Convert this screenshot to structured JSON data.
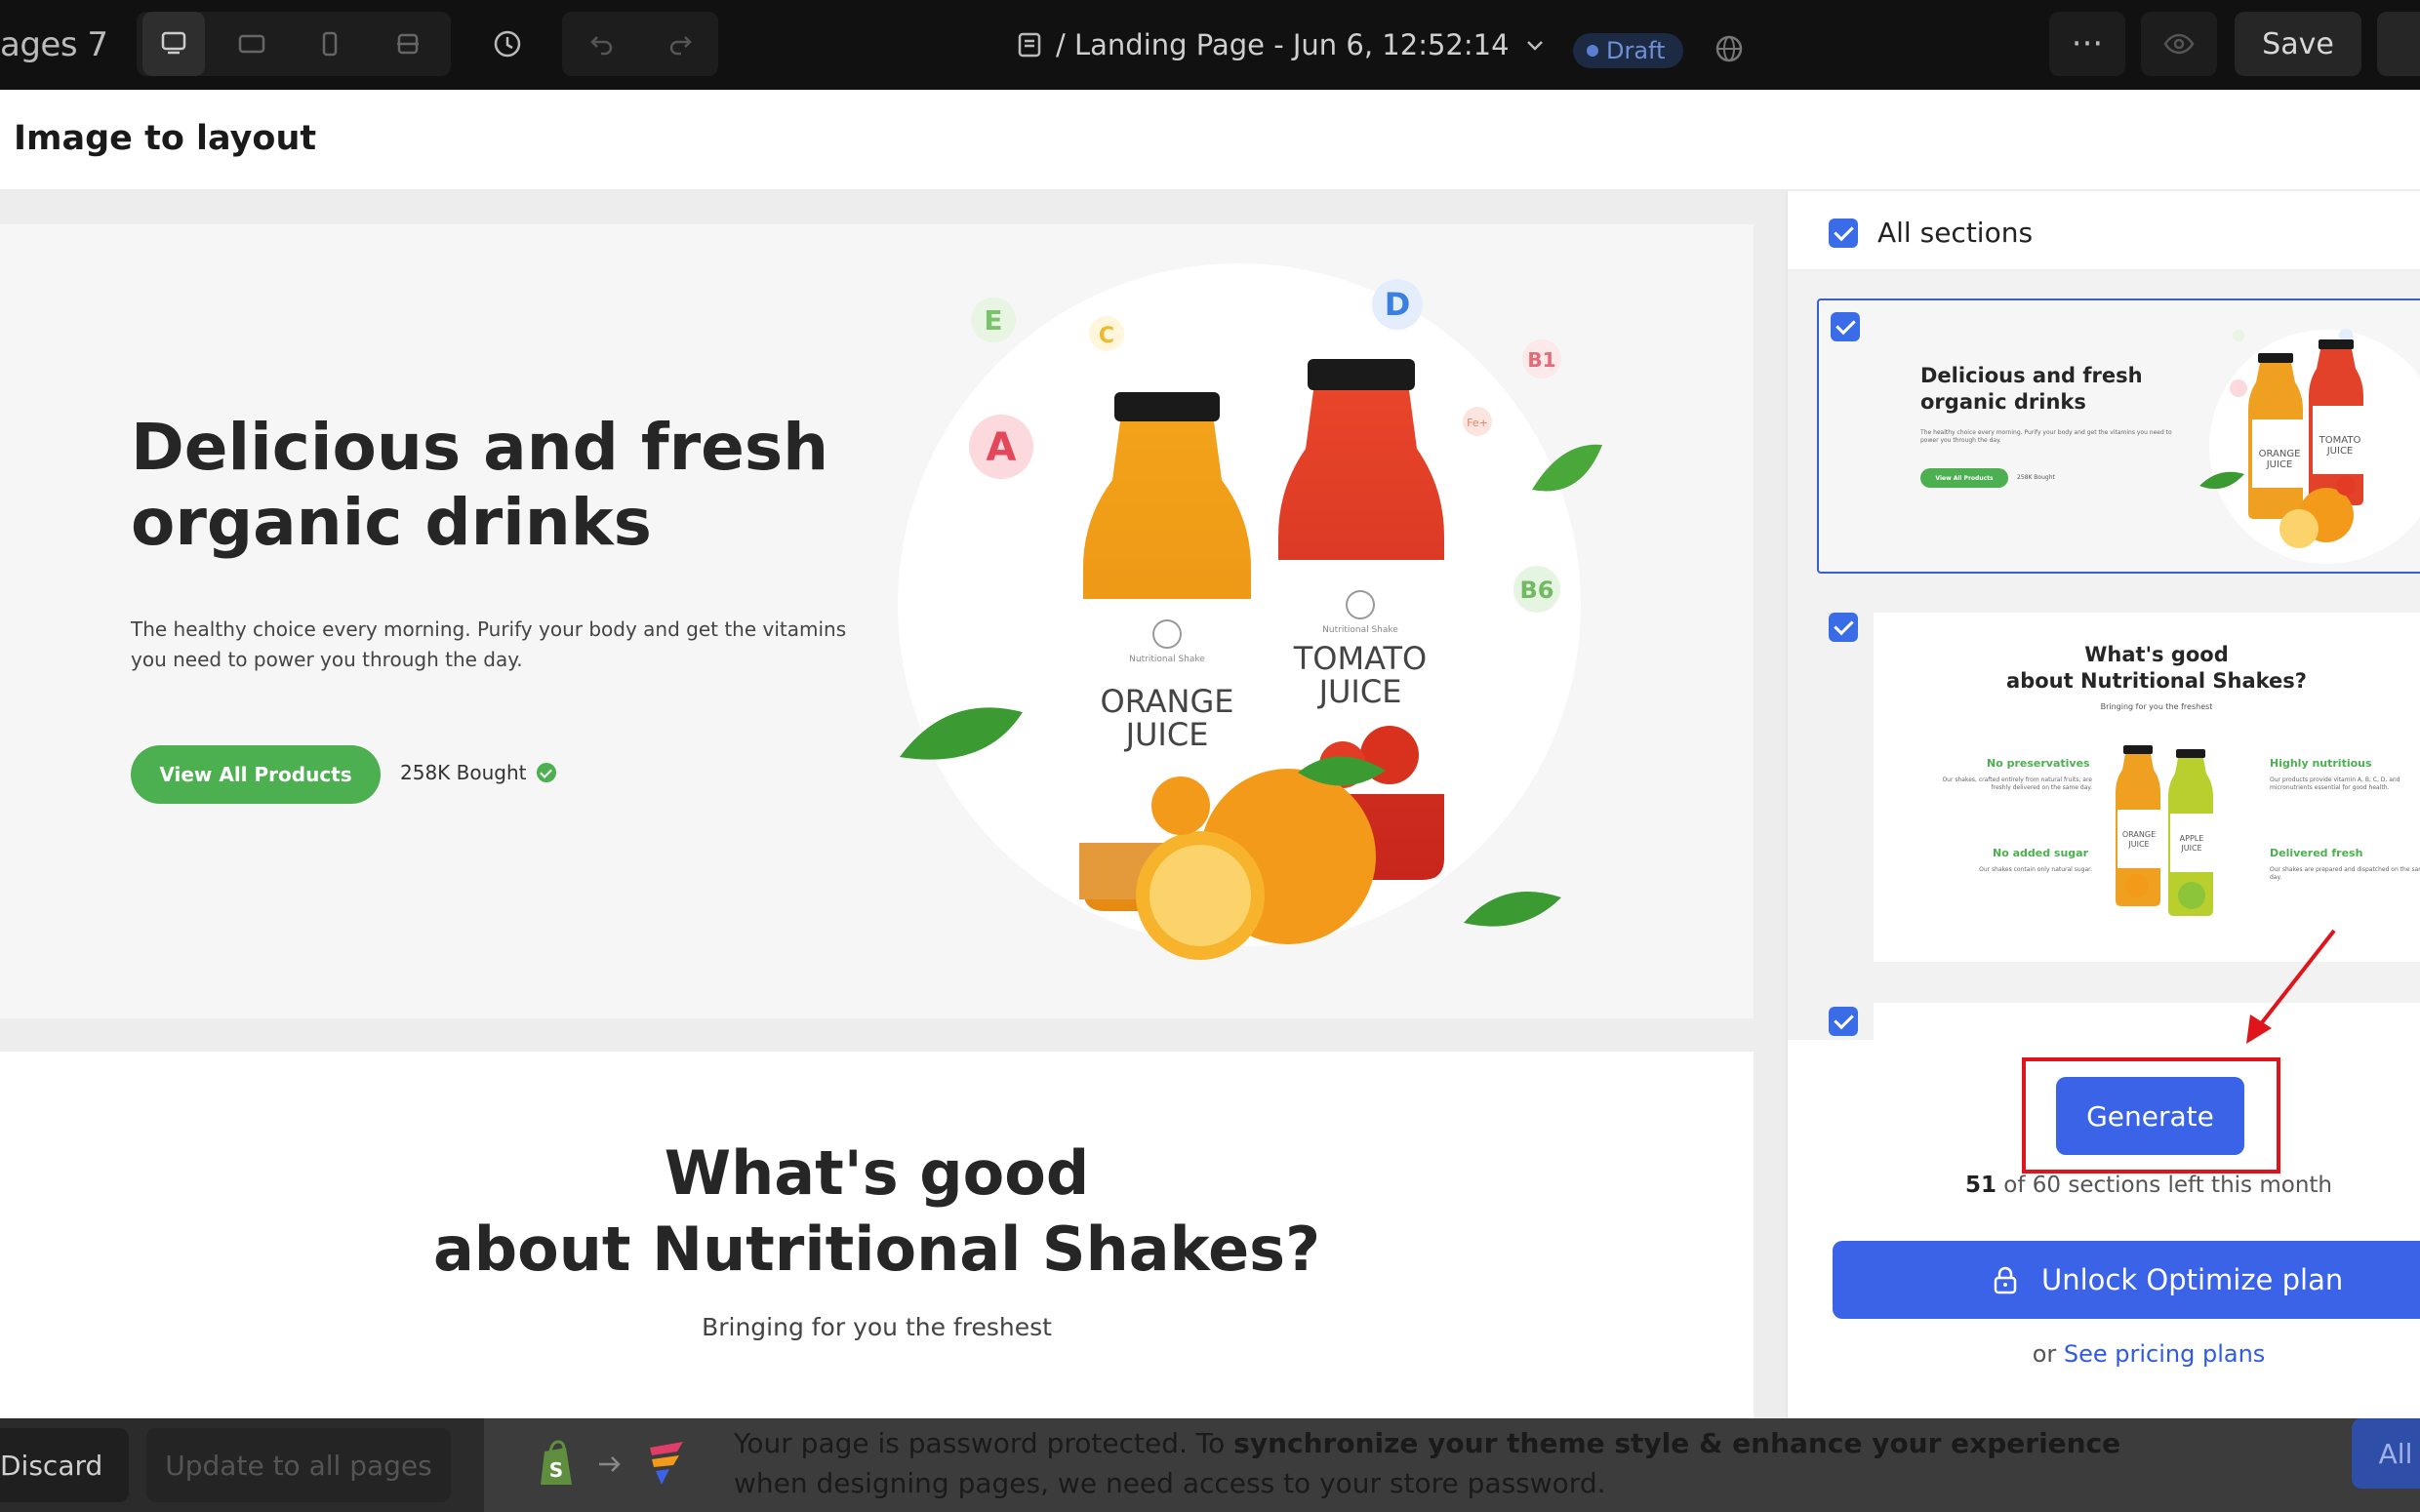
{
  "topbar": {
    "brand": "ages 7",
    "page_title": "/ Landing Page - Jun 6, 12:52:14",
    "draft": "Draft",
    "more": "···",
    "save": "Save"
  },
  "modal": {
    "title": "Image to layout"
  },
  "hero": {
    "title": "Delicious and fresh organic drinks",
    "text": "The healthy choice every morning. Purify your body and get the vitamins you need to power you through the day.",
    "button": "View All Products",
    "bought": "258K Bought",
    "vitamins": [
      "E",
      "C",
      "D",
      "B1",
      "A",
      "Fe+",
      "B6"
    ],
    "bottle1": [
      "ORANGE",
      "JUICE"
    ],
    "bottle2": [
      "TOMATO",
      "JUICE"
    ],
    "bottle_brand": "Nutritional Shake"
  },
  "section2": {
    "title_line1": "What's good",
    "title_line2": "about Nutritional Shakes?",
    "subtitle": "Bringing for you the freshest"
  },
  "panel": {
    "all_sections": "All sections",
    "thumb1": {
      "title": "Delicious and fresh organic drinks",
      "text": "The healthy choice every morning. Purify your body and get the vitamins you need to power you through the day.",
      "button": "View All Products",
      "bought": "258K Bought"
    },
    "thumb2": {
      "title_line1": "What's good",
      "title_line2": "about Nutritional Shakes?",
      "subtitle": "Bringing for you the freshest",
      "features": [
        {
          "title": "No preservatives",
          "text": "Our shakes, crafted entirely from natural fruits, are freshly delivered on the same day."
        },
        {
          "title": "Highly nutritious",
          "text": "Our products provide vitamin A, B, C, D, and micronutrients essential for good health."
        },
        {
          "title": "No added sugar",
          "text": "Our shakes contain only natural sugar."
        },
        {
          "title": "Delivered fresh",
          "text": "Our shakes are prepared and dispatched on the same day."
        }
      ],
      "bottle1": [
        "ORANGE",
        "JUICE"
      ],
      "bottle2": [
        "APPLE",
        "JUICE"
      ]
    },
    "generate": "Generate",
    "sections_used": "51",
    "sections_rest": " of 60 sections left this month",
    "unlock": "Unlock Optimize plan",
    "or": "or ",
    "pricing_link": "See pricing plans"
  },
  "bottombar": {
    "discard": "Discard",
    "update": "Update to all pages",
    "notice_plain1": "Your page is password protected. To ",
    "notice_bold": "synchronize your theme style & enhance your experience",
    "notice_plain2": " when designing pages, we need access to your store password.",
    "notice_button": "All"
  },
  "colors": {
    "accent": "#3a63e8",
    "green": "#4caf50",
    "highlight_box": "#e0151b",
    "topbar": "#111111"
  },
  "icons": [
    "desktop-icon",
    "tablet-landscape-icon",
    "mobile-icon",
    "fullscreen-icon",
    "history-icon",
    "undo-icon",
    "redo-icon",
    "page-icon",
    "chevron-down-icon",
    "globe-icon",
    "eye-icon",
    "lock-icon",
    "shopify-icon",
    "arrow-right-icon",
    "app-logo-icon"
  ]
}
